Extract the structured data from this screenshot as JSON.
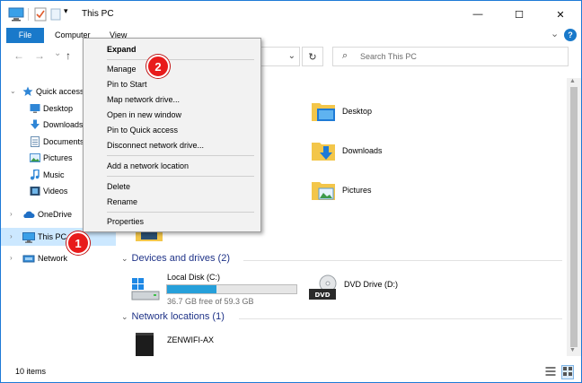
{
  "window": {
    "title": "This PC",
    "controls": {
      "minimize": "—",
      "maximize": "☐",
      "close": "✕"
    }
  },
  "ribbon": {
    "tabs": [
      "File",
      "Computer",
      "View"
    ],
    "expand_glyph": "⌄",
    "help_glyph": "?"
  },
  "nav": {
    "back_glyph": "←",
    "forward_glyph": "→",
    "recent_glyph": "⌄",
    "up_glyph": "↑",
    "address_dropdown_glyph": "⌄",
    "refresh_glyph": "↻",
    "search_placeholder": "Search This PC",
    "search_glyph": "⌕"
  },
  "sidebar": {
    "items": [
      {
        "label": "Quick access",
        "icon": "star-icon"
      },
      {
        "label": "Desktop",
        "icon": "desktop-icon"
      },
      {
        "label": "Downloads",
        "icon": "download-icon"
      },
      {
        "label": "Documents",
        "icon": "document-icon"
      },
      {
        "label": "Pictures",
        "icon": "pictures-icon"
      },
      {
        "label": "Music",
        "icon": "music-icon"
      },
      {
        "label": "Videos",
        "icon": "videos-icon"
      },
      {
        "label": "OneDrive",
        "icon": "cloud-icon"
      },
      {
        "label": "This PC",
        "icon": "computer-icon"
      },
      {
        "label": "Network",
        "icon": "network-icon"
      }
    ]
  },
  "content": {
    "folders": [
      {
        "label": "Desktop"
      },
      {
        "label": "Downloads"
      },
      {
        "label": "Pictures"
      }
    ],
    "groups": {
      "devices": "Devices and drives (2)",
      "network": "Network locations (1)"
    },
    "drives": [
      {
        "name": "Local Disk (C:)",
        "free_text": "36.7 GB free of 59.3 GB",
        "used_fraction": 0.38
      },
      {
        "name": "DVD Drive (D:)"
      }
    ],
    "network_locations": [
      {
        "name": "ZENWIFI-AX"
      }
    ]
  },
  "status": {
    "item_count": "10 items"
  },
  "context_menu": {
    "items": [
      "Expand",
      "Manage",
      "Pin to Start",
      "Map network drive...",
      "Open in new window",
      "Pin to Quick access",
      "Disconnect network drive...",
      "Add a network location",
      "Delete",
      "Rename",
      "Properties"
    ]
  },
  "callouts": [
    "1",
    "2"
  ],
  "colors": {
    "accent": "#1979ca",
    "selection": "#cce8ff",
    "badge": "#e81b1b",
    "group_header": "#1e3287",
    "drive_fill": "#26a0da"
  }
}
